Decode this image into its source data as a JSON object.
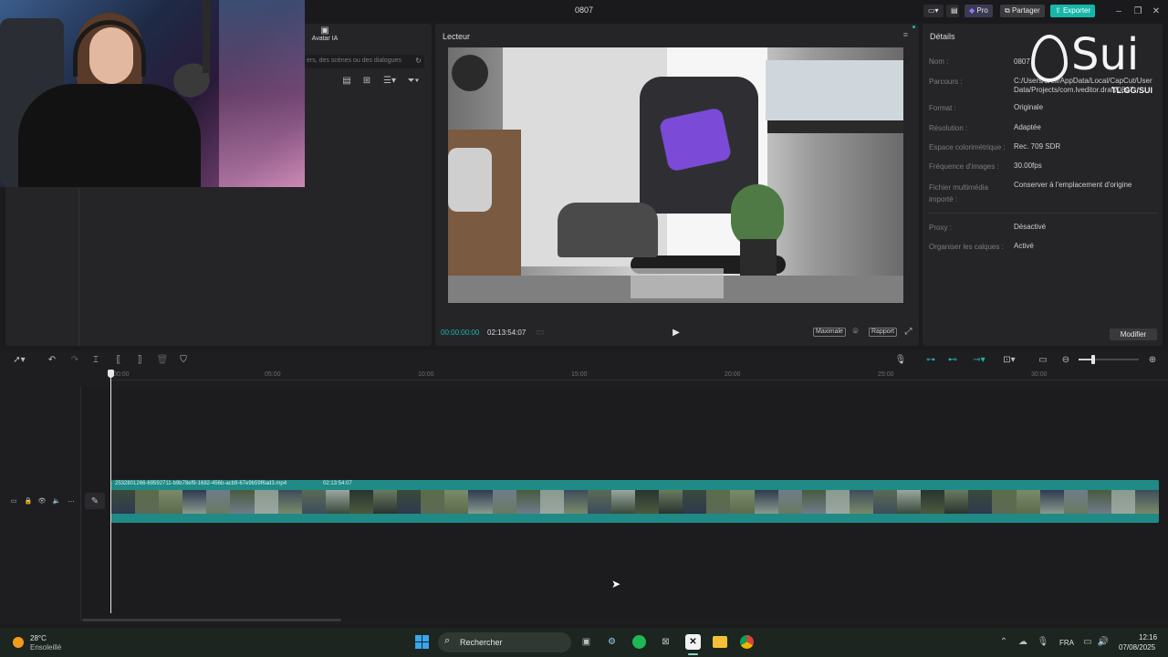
{
  "window": {
    "title": "0807"
  },
  "topbar": {
    "pro_label": "Pro",
    "share_label": "Partager",
    "export_label": "Exporter"
  },
  "media_panel": {
    "avatar_label": "Avatar IA",
    "search_placeholder": "ers, des scènes ou des dialogues"
  },
  "player": {
    "title": "Lecteur",
    "current_time": "00:00:00:00",
    "total_time": "02:13:54:07",
    "quality_label": "Maximale",
    "ratio_label": "Rapport"
  },
  "details": {
    "title": "Détails",
    "rows": [
      {
        "label": "Nom :",
        "value": "0807"
      },
      {
        "label": "Parcours :",
        "value": "C:/Users/arell/AppData/Local/CapCut/User Data/Projects/com.lveditor.draft/0807"
      },
      {
        "label": "Format :",
        "value": "Originale"
      },
      {
        "label": "Résolution :",
        "value": "Adaptée"
      },
      {
        "label": "Espace colorimétrique :",
        "value": "Rec. 709 SDR"
      },
      {
        "label": "Fréquence d'images :",
        "value": "30.00fps"
      },
      {
        "label": "Fichier multimédia importé :",
        "value": "Conserver à l'emplacement d'origine"
      },
      {
        "label": "Proxy :",
        "value": "Désactivé"
      },
      {
        "label": "Organiser les calques :",
        "value": "Activé"
      }
    ],
    "modify_label": "Modifier"
  },
  "watermark": {
    "brand": "Sui",
    "handle": "TL.GG/SUI"
  },
  "timeline": {
    "ruler": [
      "00:00",
      "05:00",
      "10:00",
      "15:00",
      "20:00",
      "25:00",
      "30:00"
    ],
    "clip_name": "2532801266-69592711-b9b78ef9-1682-456b-acb9-67e9b59f6ad3.mp4",
    "clip_duration": "02:13:54:07"
  },
  "taskbar": {
    "weather_temp": "28°C",
    "weather_desc": "Ensoleillé",
    "search_label": "Rechercher",
    "language": "FRA",
    "time": "12:16",
    "date": "07/08/2025"
  },
  "colors": {
    "accent": "#1fb5ad",
    "export_bg": "#16b7a8",
    "clip": "#1f8a86",
    "panel": "#252528"
  }
}
